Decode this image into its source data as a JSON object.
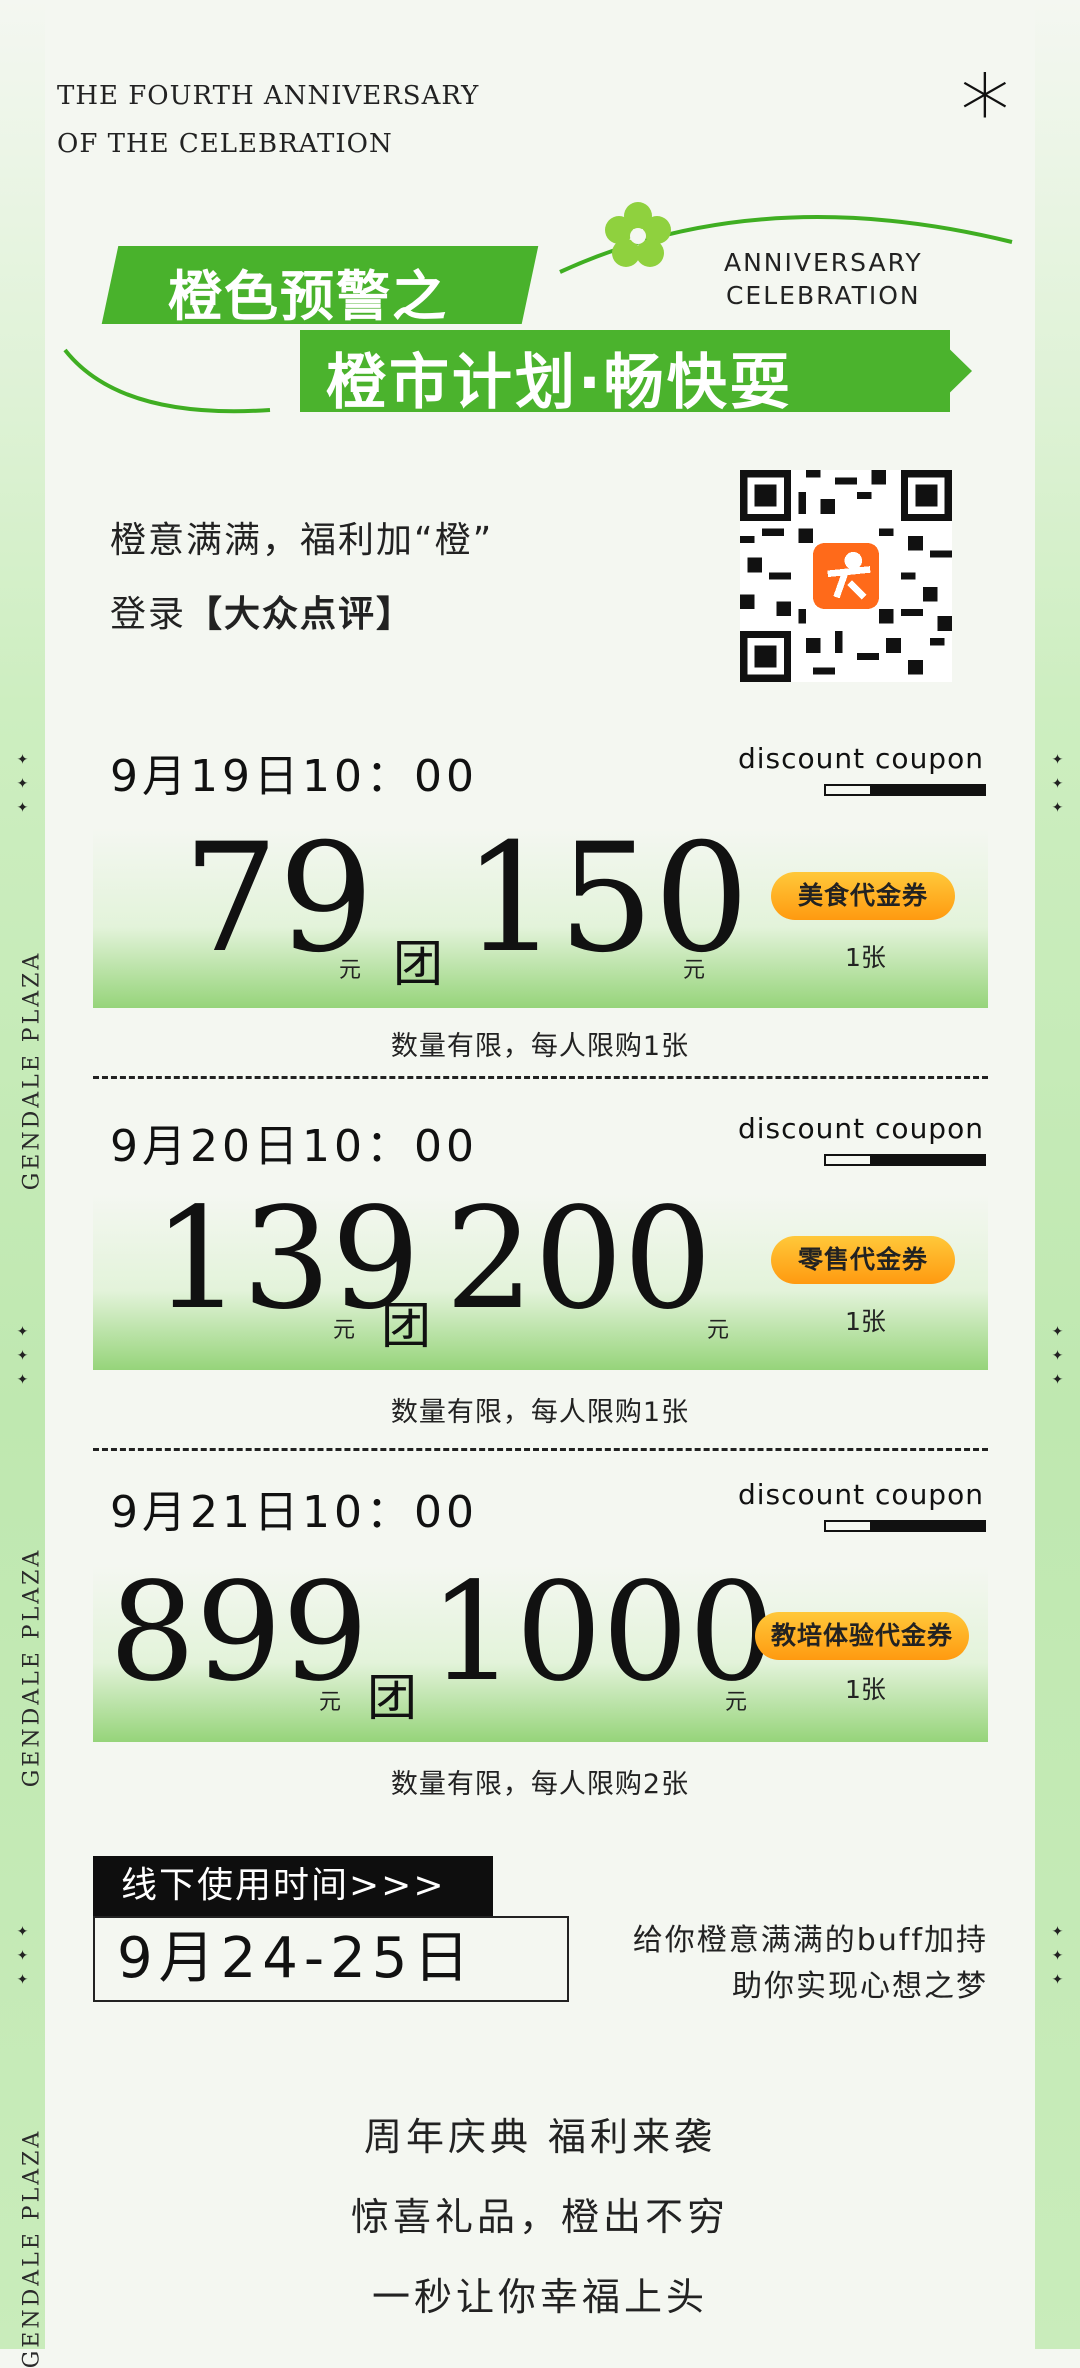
{
  "header": {
    "line1": "THE FOURTH ANNIVERSARY",
    "line2": "OF THE CELEBRATION",
    "asterisk": "*"
  },
  "title": {
    "banner1": "橙色预警之",
    "banner2": "橙市计划·畅快耍",
    "anniv1": "ANNIVERSARY",
    "anniv2": "CELEBRATION"
  },
  "intro": {
    "line1": "橙意满满，福利加“橙”",
    "line2_prefix": "登录",
    "line2_bold": "【大众点评】"
  },
  "side": {
    "text": "GENDALE PLAZA",
    "star": "✦"
  },
  "coupons": [
    {
      "date": "9月19日10：00",
      "tag": "discount coupon",
      "price": "79",
      "value": "150",
      "yuan": "元",
      "tuan": "团",
      "type": "美食代金券",
      "count": "1张",
      "limit": "数量有限，每人限购1张"
    },
    {
      "date": "9月20日10：00",
      "tag": "discount coupon",
      "price": "139",
      "value": "200",
      "yuan": "元",
      "tuan": "团",
      "type": "零售代金券",
      "count": "1张",
      "limit": "数量有限，每人限购1张"
    },
    {
      "date": "9月21日10：00",
      "tag": "discount coupon",
      "price": "899",
      "value": "1000",
      "yuan": "元",
      "tuan": "团",
      "type": "教培体验代金券",
      "count": "1张",
      "limit": "数量有限，每人限购2张"
    }
  ],
  "offline": {
    "label": "线下使用时间>>>",
    "dates": "9月24-25日",
    "buff1": "给你橙意满满的buff加持",
    "buff2": "助你实现心想之梦"
  },
  "footer": {
    "line1": "周年庆典 福利来袭",
    "line2": "惊喜礼品，橙出不穷",
    "line3": "一秒让你幸福上头"
  },
  "colors": {
    "green": "#4bb32d",
    "orange": "#ff9a10",
    "bg": "#f4f7f1"
  }
}
